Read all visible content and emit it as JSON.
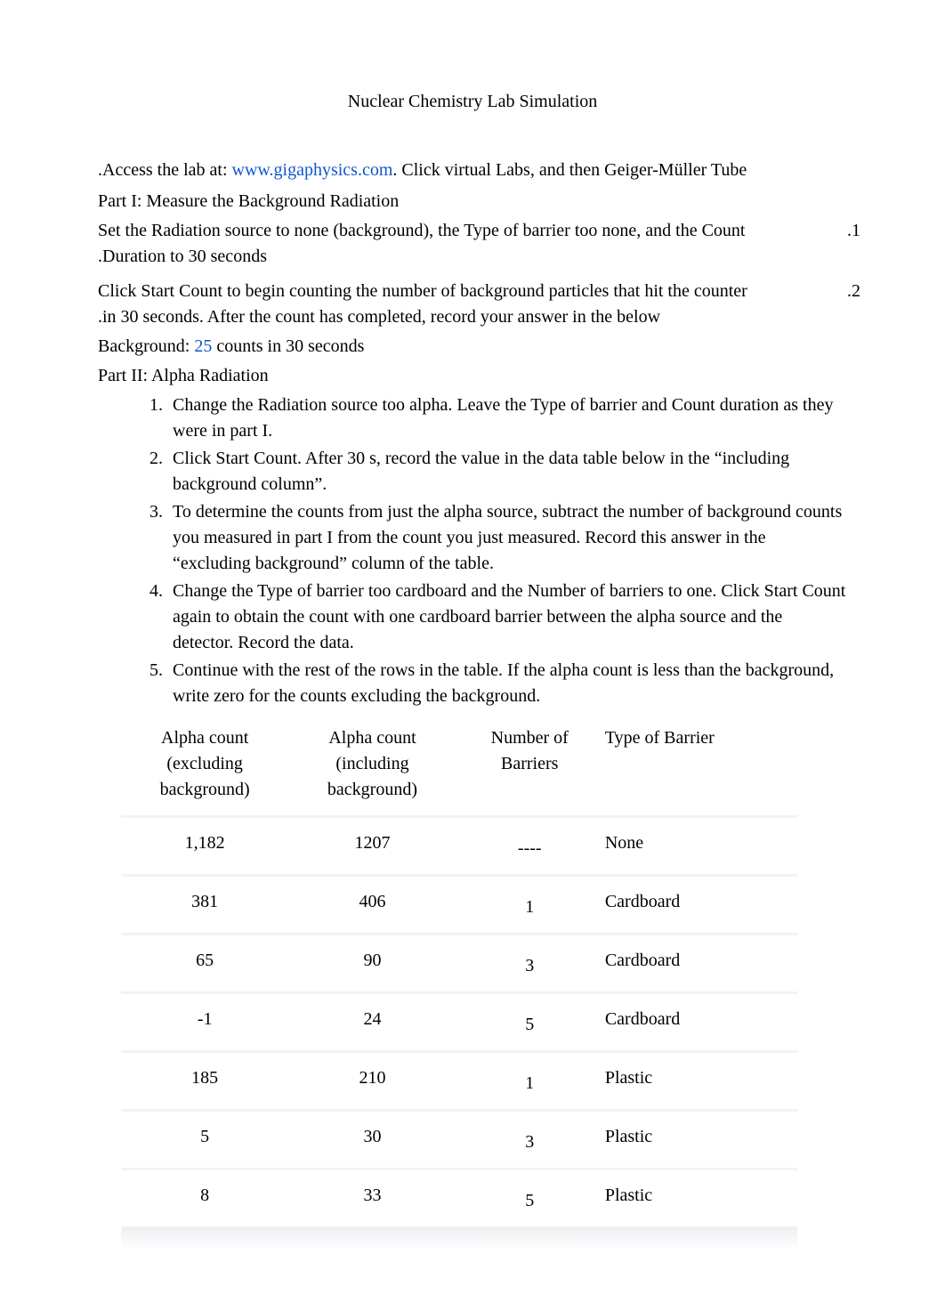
{
  "title": "Nuclear Chemistry Lab Simulation",
  "intro": {
    "prefix": ".Access the lab at: ",
    "link_text": "www.gigaphysics.com",
    "link_href": "#",
    "suffix": ". Click virtual Labs, and then Geiger-Müller Tube"
  },
  "part1": {
    "heading": "Part I: Measure the Background Radiation",
    "step1_a": "Set the Radiation source to none (background), the Type of barrier too none, and the Count",
    "step1_num": ".1",
    "step1_b": ".Duration to 30 seconds",
    "step2_a": "Click Start Count to begin counting the number of background particles that hit the counter",
    "step2_num": ".2",
    "step2_b": ".in 30 seconds. After the count has completed, record your answer in the below",
    "background_label": "Background:",
    "background_value": "25",
    "background_suffix": "counts in 30 seconds"
  },
  "part2": {
    "heading": "Part II: Alpha Radiation",
    "steps": [
      "Change the Radiation source too alpha. Leave the Type of barrier and Count duration as they were in part I.",
      "Click Start Count. After 30 s, record the value in the data table below in the “including background column”.",
      "To determine the counts from just the alpha source, subtract the number of background counts you measured in part I from the count you just measured. Record this answer in the “excluding background” column of the table.",
      "Change the Type of barrier too cardboard and the Number of barriers to one. Click Start Count again to obtain the count with one cardboard barrier between the alpha source and the detector. Record the data.",
      "Continue with the rest of the rows in the table. If the alpha count is less than the background, write zero for the counts excluding the background."
    ]
  },
  "table": {
    "headers": {
      "col1_l1": "Alpha count",
      "col1_l2": "(excluding",
      "col1_l3": "background)",
      "col2_l1": "Alpha count",
      "col2_l2": "(including",
      "col2_l3": "background)",
      "col3_l1": "Number of",
      "col3_l2": "Barriers",
      "col4_l1": "Type of Barrier"
    },
    "rows": [
      {
        "excl": "1,182",
        "incl": "1207",
        "num": "----",
        "type": "None"
      },
      {
        "excl": "381",
        "incl": "406",
        "num": "1",
        "type": "Cardboard"
      },
      {
        "excl": "65",
        "incl": "90",
        "num": "3",
        "type": "Cardboard"
      },
      {
        "excl": "-1",
        "incl": "24",
        "num": "5",
        "type": "Cardboard"
      },
      {
        "excl": "185",
        "incl": "210",
        "num": "1",
        "type": "Plastic"
      },
      {
        "excl": "5",
        "incl": "30",
        "num": "3",
        "type": "Plastic"
      },
      {
        "excl": "8",
        "incl": "33",
        "num": "5",
        "type": "Plastic"
      }
    ]
  }
}
